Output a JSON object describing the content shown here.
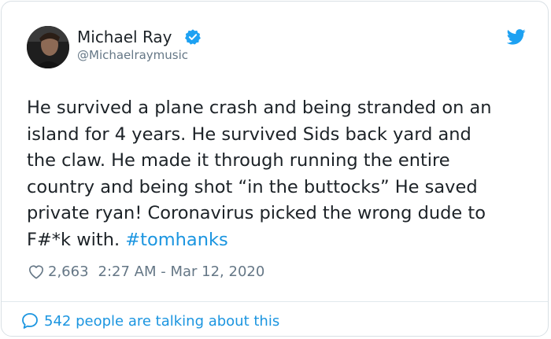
{
  "author": {
    "name": "Michael Ray",
    "handle": "@Michaelraymusic",
    "verified_icon": "verified-badge-icon",
    "avatar": "avatar-photo"
  },
  "platform_icon": "twitter-bird-icon",
  "tweet": {
    "lines": [
      "He survived a plane crash and being stranded on an",
      "island for 4 years. He survived Sids back yard and",
      "the claw. He made it through running the entire",
      "country and being shot “in the buttocks” He saved",
      "private ryan! Coronavirus picked the wrong dude to"
    ],
    "last_line_text": "F#*k with. ",
    "hashtag": "#tomhanks"
  },
  "meta": {
    "likes": "2,663",
    "timestamp": "2:27 AM - Mar 12, 2020"
  },
  "footer": {
    "talking_text": "542 people are talking about this"
  },
  "colors": {
    "link": "#1b95e0",
    "text": "#1c2227",
    "muted": "#657786",
    "border": "#d9e0e5"
  }
}
